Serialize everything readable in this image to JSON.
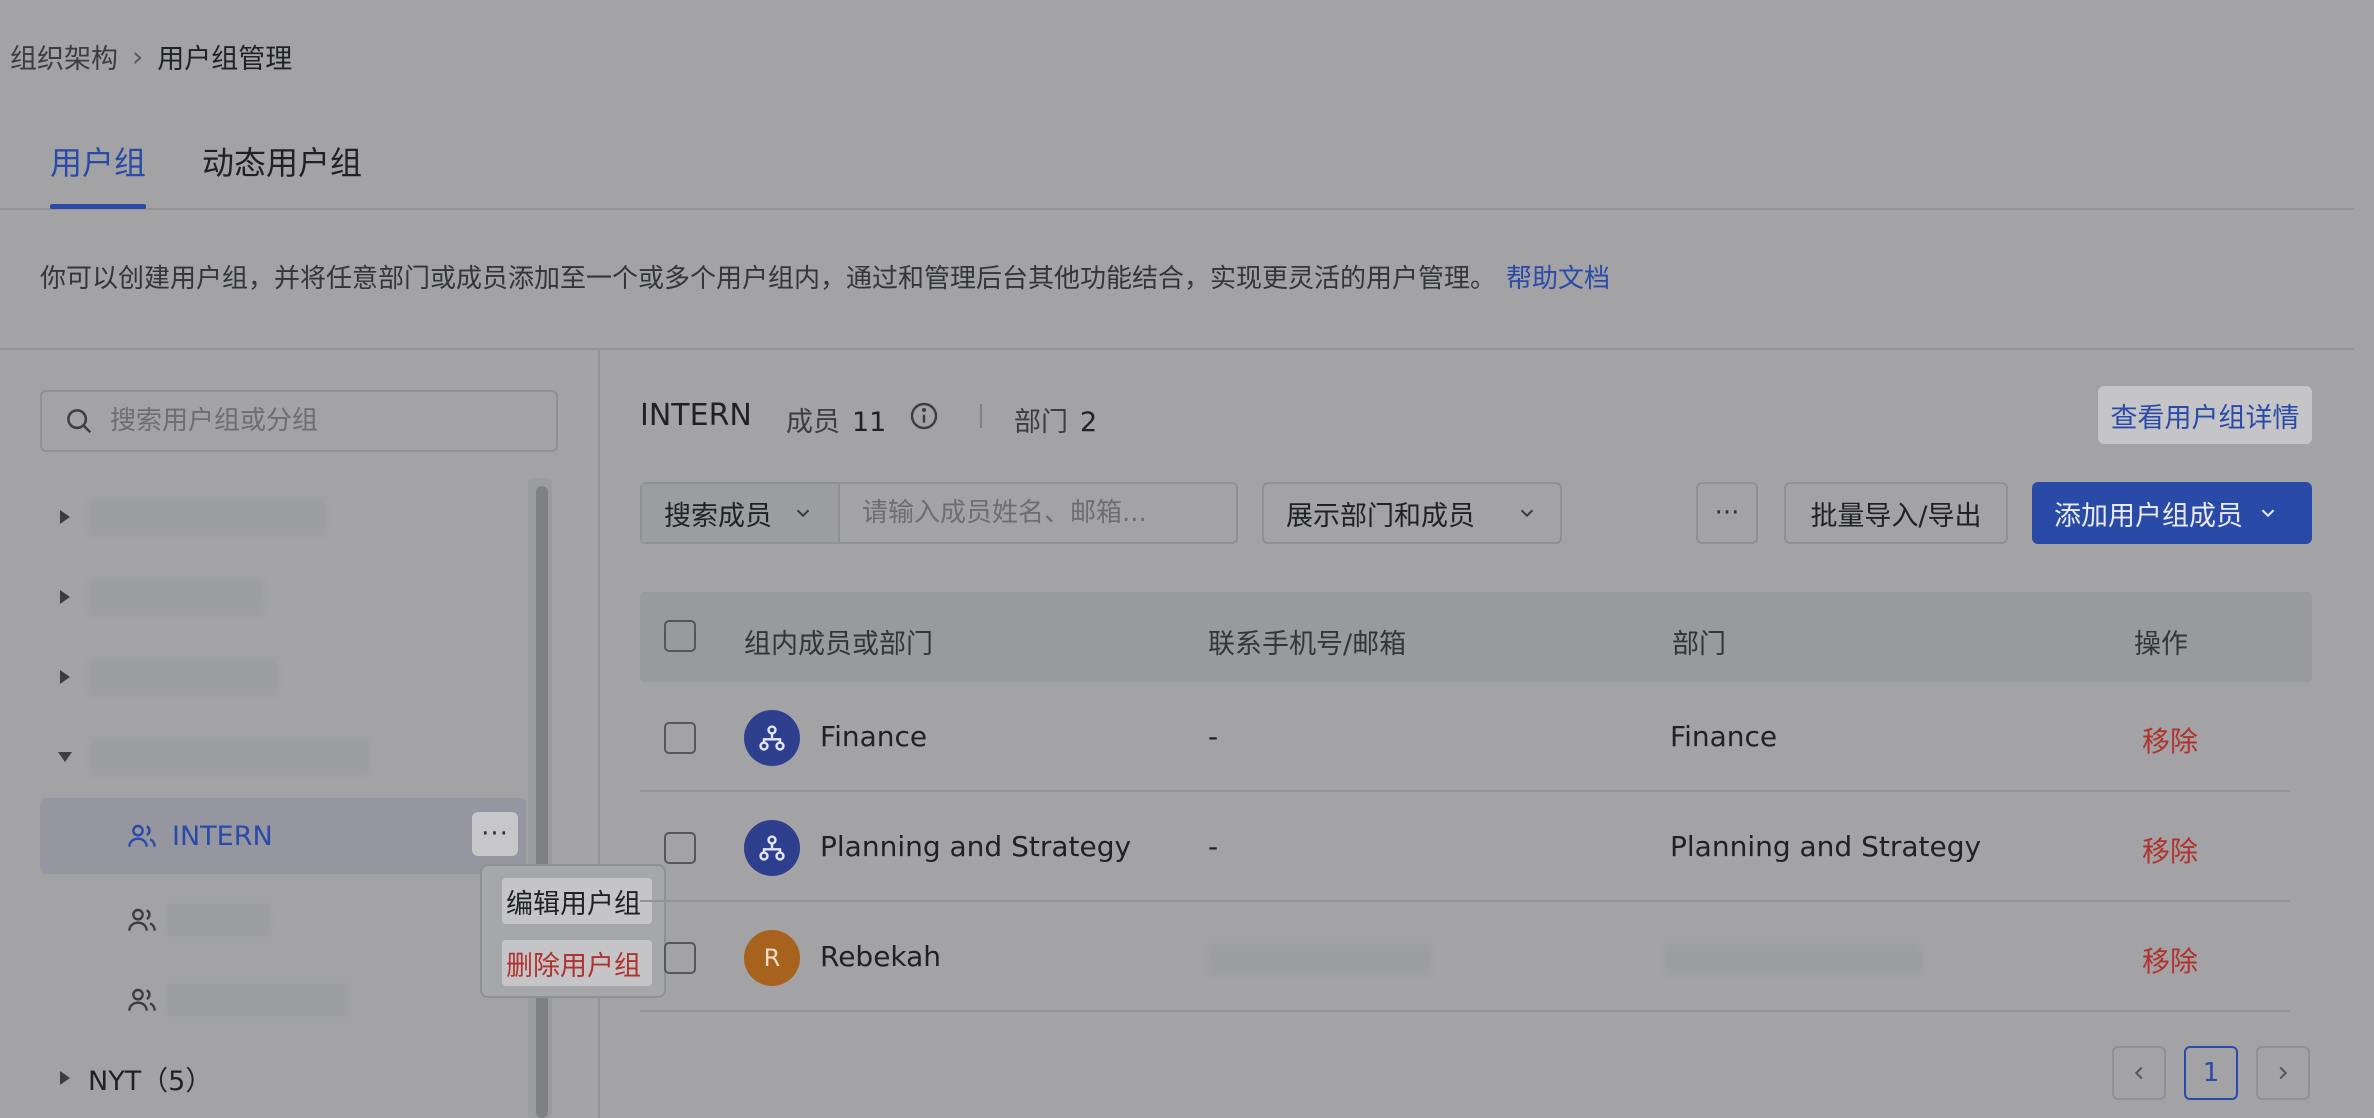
{
  "breadcrumb": {
    "parent": "组织架构",
    "current": "用户组管理"
  },
  "tabs": [
    {
      "label": "用户组"
    },
    {
      "label": "动态用户组"
    }
  ],
  "description": {
    "text": "你可以创建用户组，并将任意部门或成员添加至一个或多个用户组内，通过和管理后台其他功能结合，实现更灵活的用户管理。",
    "help_link": "帮助文档"
  },
  "sidebar": {
    "search_placeholder": "搜索用户组或分组",
    "selected_group": "INTERN",
    "context_menu": {
      "edit": "编辑用户组",
      "delete": "删除用户组"
    },
    "nyt_label": "NYT（5）"
  },
  "group": {
    "name": "INTERN",
    "members_label": "成员",
    "members_count": "11",
    "departments_label": "部门",
    "departments_count": "2",
    "view_details": "查看用户组详情"
  },
  "toolbar": {
    "search_select": "搜索成员",
    "search_placeholder": "请输入成员姓名、邮箱...",
    "show_filter": "展示部门和成员",
    "more": "···",
    "import_export": "批量导入/导出",
    "add_member": "添加用户组成员"
  },
  "table": {
    "columns": [
      "组内成员或部门",
      "联系手机号/邮箱",
      "部门",
      "操作"
    ],
    "rows": [
      {
        "type": "department",
        "name": "Finance",
        "contact": "-",
        "department": "Finance",
        "action": "移除"
      },
      {
        "type": "department",
        "name": "Planning and Strategy",
        "contact": "-",
        "department": "Planning and Strategy",
        "action": "移除"
      },
      {
        "type": "user",
        "avatar_letter": "R",
        "name": "Rebekah",
        "contact": "",
        "department": "",
        "action": "移除"
      }
    ]
  },
  "pagination": {
    "current_page": "1"
  },
  "colors": {
    "accent": "#2a4aa8",
    "danger": "#b0322e",
    "overlay": "#a3a3a5"
  },
  "icons": [
    "chevron-right-icon",
    "search-icon",
    "caret-right-icon",
    "caret-down-icon",
    "users-icon",
    "info-icon",
    "chevron-down-icon",
    "department-icon",
    "chevron-left-icon"
  ]
}
